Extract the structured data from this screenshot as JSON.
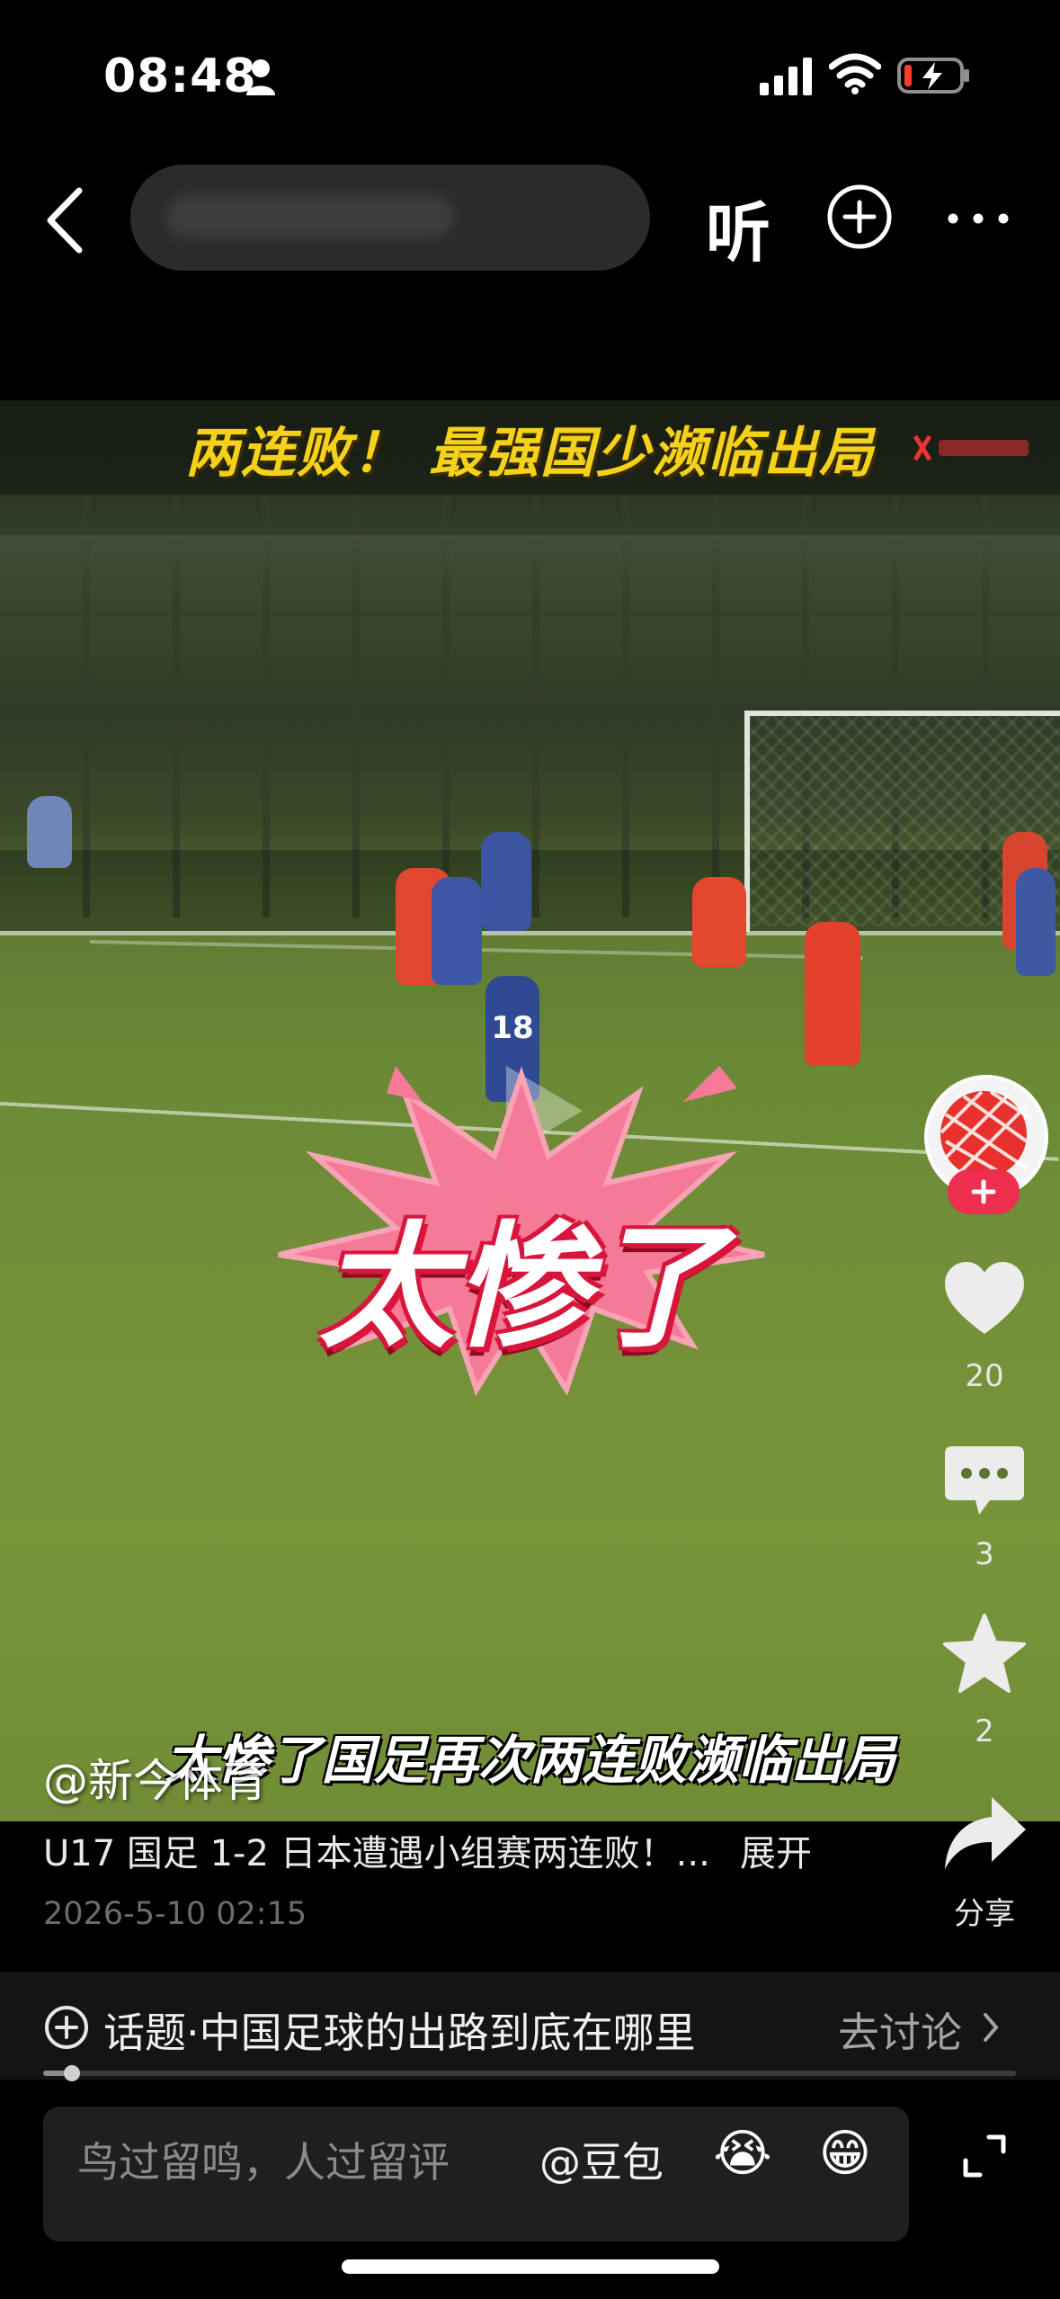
{
  "status_bar": {
    "time": "08:48"
  },
  "nav": {
    "listen_label": "听"
  },
  "video": {
    "banner_title": "两连败！ 最强国少濒临出局",
    "overlay_text": "太惨了",
    "subtitle": "太惨了国足再次两连败濒临出局",
    "jersey_number": "18"
  },
  "actions": {
    "likes": "20",
    "comments": "3",
    "favorites": "2",
    "share_label": "分享"
  },
  "post": {
    "author": "@新今体育",
    "caption": "U17 国足 1-2 日本遭遇小组赛两连败！...",
    "expand_label": "展开",
    "date": "2026-5-10 02:15"
  },
  "topic": {
    "text": "话题·中国足球的出路到底在哪里",
    "go_label": "去讨论",
    "progress": 0.03
  },
  "comment_bar": {
    "placeholder": "鸟过留鸣，人过留评",
    "mention": "@豆包",
    "emoji_1": "😭",
    "emoji_2": "😁"
  },
  "colors": {
    "accent_red": "#ee2e4f",
    "banner_yellow": "#f4d21c"
  }
}
